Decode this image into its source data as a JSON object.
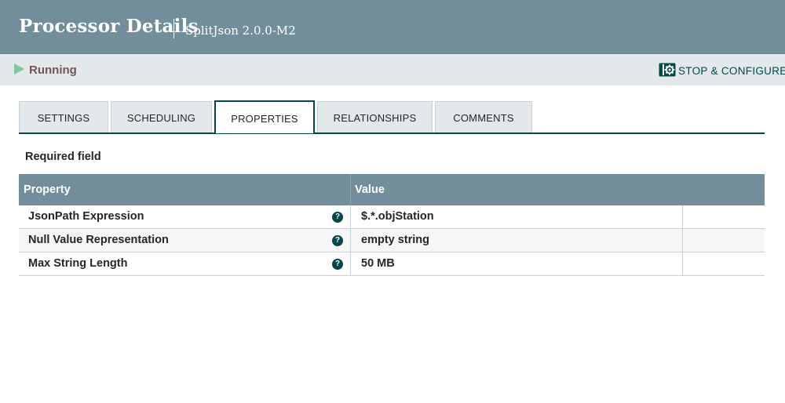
{
  "header": {
    "title": "Processor Details",
    "subtitle": "SplitJson 2.0.0-M2"
  },
  "status": {
    "state": "Running",
    "stop_button_label": "STOP & CONFIGURE",
    "running_icon": "play-icon",
    "stop_icon": "gear-icon"
  },
  "tabs": [
    {
      "label": "SETTINGS"
    },
    {
      "label": "SCHEDULING"
    },
    {
      "label": "PROPERTIES"
    },
    {
      "label": "RELATIONSHIPS"
    },
    {
      "label": "COMMENTS"
    }
  ],
  "active_tab": "PROPERTIES",
  "properties": {
    "required_label": "Required field",
    "columns": {
      "property": "Property",
      "value": "Value"
    },
    "rows": [
      {
        "name": "JsonPath Expression",
        "value": "$.*.objStation",
        "help": "?"
      },
      {
        "name": "Null Value Representation",
        "value": "empty string",
        "help": "?"
      },
      {
        "name": "Max String Length",
        "value": "50 MB",
        "help": "?"
      }
    ]
  },
  "colors": {
    "header_bg": "#728e9b",
    "accent": "#004849",
    "running_icon": "#7dc7a0",
    "running_text": "#775351"
  }
}
